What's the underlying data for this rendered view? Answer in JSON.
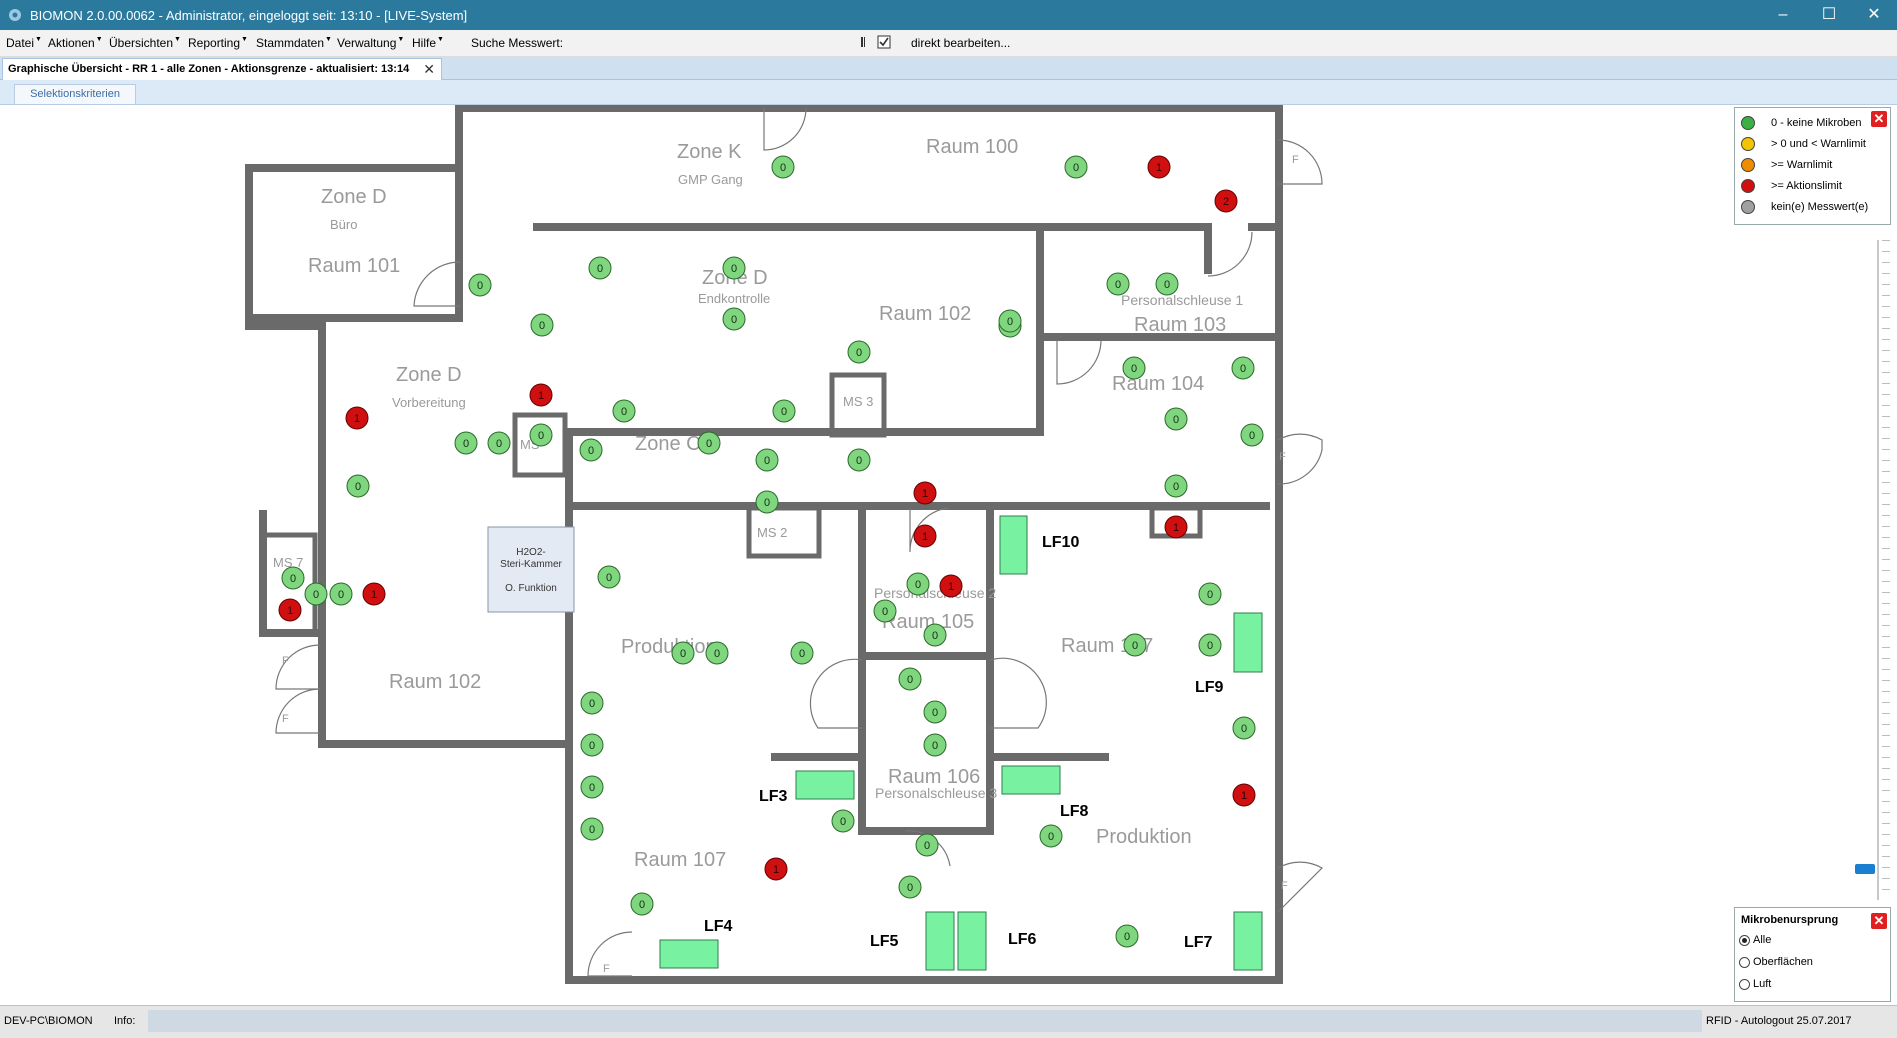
{
  "window": {
    "title": "BIOMON 2.0.00.0062 - Administrator, eingeloggt seit: 13:10 - [LIVE-System]"
  },
  "menu": {
    "items": [
      "Datei",
      "Aktionen",
      "Übersichten",
      "Reporting",
      "Stammdaten",
      "Verwaltung",
      "Hilfe"
    ],
    "search_label": "Suche Messwert:",
    "edit_label": "direkt bearbeiten..."
  },
  "tab": {
    "title": "Graphische Übersicht - RR 1 - alle Zonen - Aktionsgrenze - aktualisiert: 13:14",
    "subtab": "Selektionskriterien"
  },
  "legend": {
    "items": [
      {
        "label": "0 - keine Mikroben",
        "color": "#3cb043"
      },
      {
        "label": "> 0 und < Warnlimit",
        "color": "#f5c400"
      },
      {
        "label": ">= Warnlimit",
        "color": "#f08c00"
      },
      {
        "label": ">= Aktionslimit",
        "color": "#d01010"
      },
      {
        "label": "kein(e) Messwert(e)",
        "color": "#a0a0a0"
      }
    ]
  },
  "origin": {
    "title": "Mikrobenursprung",
    "options": [
      "Alle",
      "Oberflächen",
      "Luft"
    ],
    "selected": "Alle"
  },
  "status": {
    "user": "DEV-PC\\BIOMON",
    "info_label": "Info:",
    "right": "RFID - Autologout 25.07.2017"
  },
  "floorplan": {
    "labels": {
      "zone_k": "Zone K",
      "gmp_gang": "GMP Gang",
      "raum_100": "Raum 100",
      "zone_d_1": "Zone D",
      "buero": "Büro",
      "raum_101": "Raum 101",
      "zone_d_2": "Zone D",
      "endkontrolle": "Endkontrolle",
      "raum_102_a": "Raum 102",
      "personalschleuse_1": "Personalschleuse 1",
      "raum_103": "Raum 103",
      "zone_d_3": "Zone D",
      "vorbereitung": "Vorbereitung",
      "raum_104": "Raum 104",
      "ms3": "MS 3",
      "zone_c": "Zone C",
      "ms_small": "MS",
      "ms2": "MS 2",
      "ms7": "MS 7",
      "steri_1": "H2O2-",
      "steri_2": "Steri-Kammer",
      "steri_3": "O. Funktion",
      "personalschleuse_2": "Personalschleuse 2",
      "raum_105": "Raum 105",
      "produktion_1": "Produktion",
      "raum_102_b": "Raum 102",
      "raum_107_r": "Raum 107",
      "raum_106": "Raum 106",
      "personalschleuse_3": "Personalschleuse 3",
      "produktion_2": "Produktion",
      "raum_107": "Raum 107",
      "lf10": "LF10",
      "lf9": "LF9",
      "lf3": "LF3",
      "lf8": "LF8",
      "lf4": "LF4",
      "lf5": "LF5",
      "lf6": "LF6",
      "lf7": "LF7",
      "door_f": "F"
    },
    "markers": [
      {
        "v": "0",
        "s": "ok"
      },
      {
        "v": "0",
        "s": "ok"
      },
      {
        "v": "1",
        "s": "action"
      },
      {
        "v": "2",
        "s": "action"
      },
      {
        "v": "0",
        "s": "ok"
      },
      {
        "v": "0",
        "s": "ok"
      },
      {
        "v": "0",
        "s": "ok"
      },
      {
        "v": "0",
        "s": "ok"
      },
      {
        "v": "0",
        "s": "ok"
      },
      {
        "v": "1",
        "s": "action"
      },
      {
        "v": "0",
        "s": "ok"
      },
      {
        "v": "0",
        "s": "ok"
      },
      {
        "v": "0",
        "s": "ok"
      },
      {
        "v": "0",
        "s": "ok"
      },
      {
        "v": "1",
        "s": "action"
      },
      {
        "v": "0",
        "s": "ok"
      },
      {
        "v": "0",
        "s": "ok"
      },
      {
        "v": "0",
        "s": "ok"
      },
      {
        "v": "0",
        "s": "ok"
      },
      {
        "v": "0",
        "s": "ok"
      },
      {
        "v": "0",
        "s": "ok"
      },
      {
        "v": "0",
        "s": "ok"
      },
      {
        "v": "0",
        "s": "ok"
      },
      {
        "v": "0",
        "s": "ok"
      },
      {
        "v": "0",
        "s": "ok"
      },
      {
        "v": "0",
        "s": "ok"
      },
      {
        "v": "0",
        "s": "ok"
      },
      {
        "v": "1",
        "s": "action"
      },
      {
        "v": "1",
        "s": "action"
      },
      {
        "v": "0",
        "s": "ok"
      },
      {
        "v": "0",
        "s": "ok"
      },
      {
        "v": "0",
        "s": "ok"
      },
      {
        "v": "1",
        "s": "action"
      },
      {
        "v": "0",
        "s": "ok"
      },
      {
        "v": "0",
        "s": "ok"
      },
      {
        "v": "0",
        "s": "ok"
      },
      {
        "v": "0",
        "s": "ok"
      },
      {
        "v": "1",
        "s": "action"
      },
      {
        "v": "1",
        "s": "action"
      },
      {
        "v": "0",
        "s": "ok"
      },
      {
        "v": "0",
        "s": "ok"
      },
      {
        "v": "1",
        "s": "action"
      },
      {
        "v": "0",
        "s": "ok"
      },
      {
        "v": "0",
        "s": "ok"
      },
      {
        "v": "0",
        "s": "ok"
      },
      {
        "v": "0",
        "s": "ok"
      },
      {
        "v": "0",
        "s": "ok"
      },
      {
        "v": "0",
        "s": "ok"
      },
      {
        "v": "0",
        "s": "ok"
      },
      {
        "v": "0",
        "s": "ok"
      },
      {
        "v": "0",
        "s": "ok"
      },
      {
        "v": "0",
        "s": "ok"
      },
      {
        "v": "0",
        "s": "ok"
      },
      {
        "v": "1",
        "s": "action"
      },
      {
        "v": "0",
        "s": "ok"
      },
      {
        "v": "0",
        "s": "ok"
      },
      {
        "v": "0",
        "s": "ok"
      },
      {
        "v": "0",
        "s": "ok"
      },
      {
        "v": "1",
        "s": "action"
      },
      {
        "v": "0",
        "s": "ok"
      },
      {
        "v": "0",
        "s": "ok"
      },
      {
        "v": "0",
        "s": "ok"
      },
      {
        "v": "0",
        "s": "ok"
      },
      {
        "v": "0",
        "s": "ok"
      },
      {
        "v": "0",
        "s": "ok"
      },
      {
        "v": "0",
        "s": "ok"
      },
      {
        "v": "0",
        "s": "ok"
      }
    ]
  }
}
